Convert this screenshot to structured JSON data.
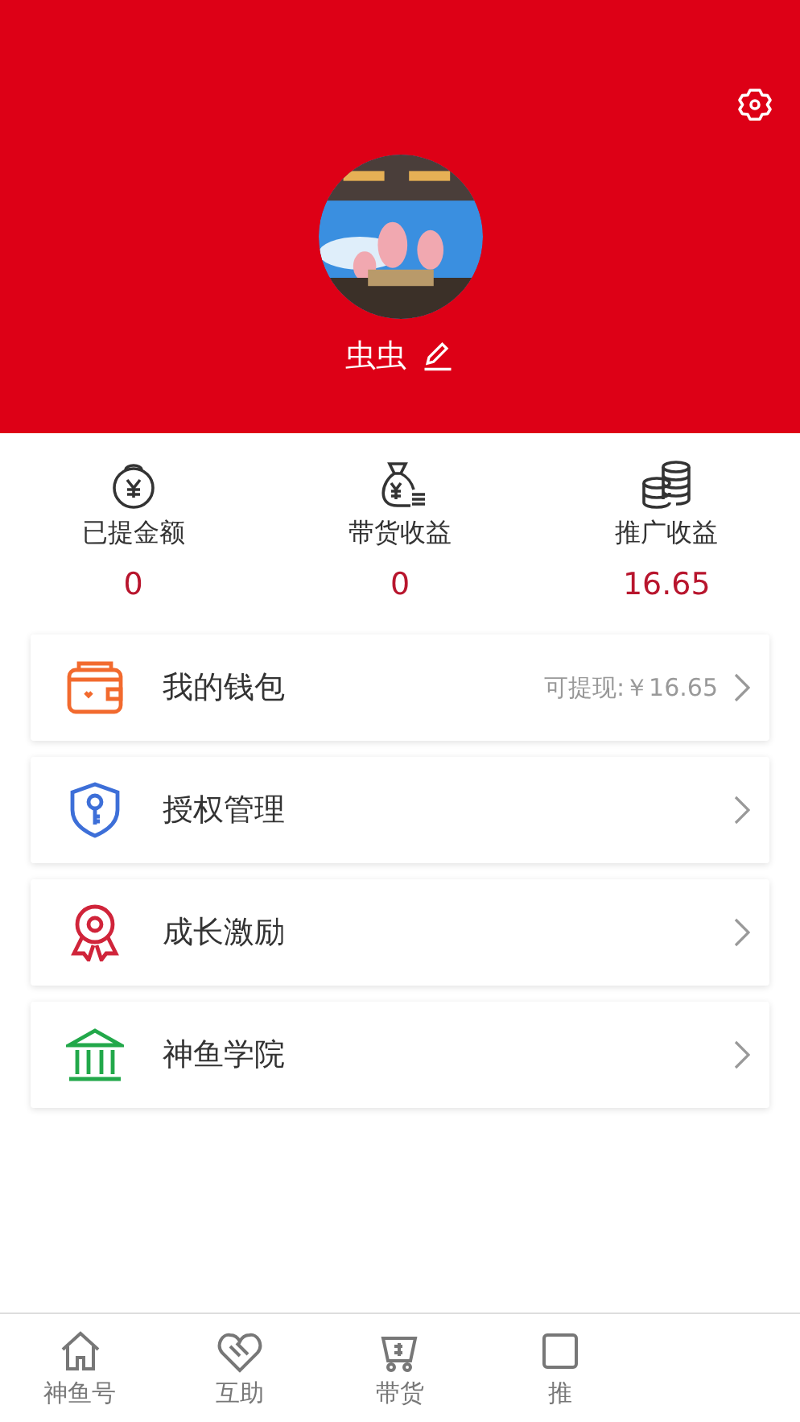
{
  "profile": {
    "name": "虫虫"
  },
  "stats": [
    {
      "kind": "withdrawn",
      "label": "已提金额",
      "value": "0"
    },
    {
      "kind": "sales",
      "label": "带货收益",
      "value": "0"
    },
    {
      "kind": "promo",
      "label": "推广收益",
      "value": "16.65"
    }
  ],
  "menu": [
    {
      "kind": "wallet",
      "label": "我的钱包",
      "detail": "可提现:￥16.65"
    },
    {
      "kind": "auth",
      "label": "授权管理"
    },
    {
      "kind": "growth",
      "label": "成长激励"
    },
    {
      "kind": "academy",
      "label": "神鱼学院"
    }
  ],
  "tab_bar": [
    {
      "kind": "home",
      "label": "神鱼号"
    },
    {
      "kind": "help",
      "label": "互助"
    },
    {
      "kind": "goods",
      "label": "带货"
    },
    {
      "kind": "promo",
      "label": "推"
    }
  ]
}
